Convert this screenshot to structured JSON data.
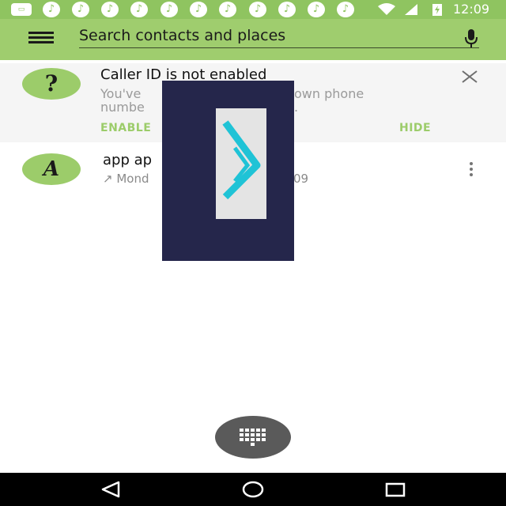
{
  "status_bar": {
    "time": "12:09",
    "notification_icons": [
      "keyboard-icon",
      "music-note-icon",
      "music-note-icon",
      "music-note-icon",
      "music-note-icon",
      "music-note-icon",
      "music-note-icon",
      "music-note-icon",
      "music-note-icon",
      "music-note-icon",
      "music-note-icon",
      "music-note-icon"
    ],
    "right_icons": [
      "wifi-icon",
      "signal-icon",
      "battery-charging-icon"
    ]
  },
  "search": {
    "placeholder": "Search contacts and places"
  },
  "caller_id_card": {
    "avatar_letter": "?",
    "title": "Caller ID is not enabled",
    "body_line1": "You've",
    "body_line1_end": "own phone",
    "body_line2": "numbe",
    "body_line2_end": ".",
    "enable_label": "ENABLE",
    "hide_label": "HIDE"
  },
  "recent_call": {
    "avatar_letter": "A",
    "name": "app ap",
    "detail_arrow": "↗",
    "detail": "Mond",
    "detail_end": "09"
  },
  "colors": {
    "accent": "#9ccc6a",
    "status_bar": "#8fc460",
    "toolbar": "#9fcd6e",
    "overlay": "#25264b",
    "overlay_icon": "#1fc3d6",
    "fab": "#5a5a5a"
  },
  "fab": {
    "icon": "dialpad-icon"
  },
  "nav_bar": {
    "icons": [
      "back-icon",
      "home-icon",
      "recents-icon"
    ]
  }
}
